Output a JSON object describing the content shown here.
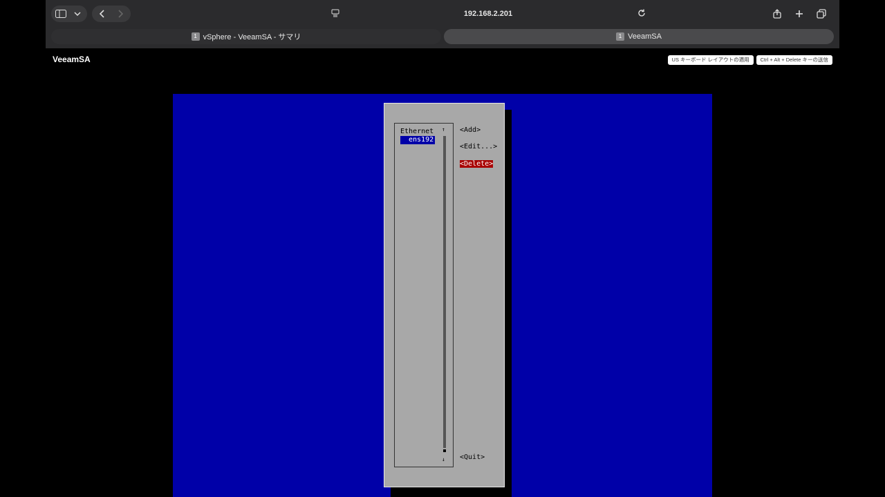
{
  "browser": {
    "address": "192.168.2.201",
    "tabs": [
      {
        "badge": "1",
        "label": "vSphere - VeeamSA - サマリ"
      },
      {
        "badge": "1",
        "label": "VeeamSA"
      }
    ]
  },
  "page": {
    "title": "VeeamSA",
    "actions": {
      "us_keyboard": "US キーボード レイアウトの適用",
      "send_cad": "Ctrl + Alt + Delete キーの送信"
    }
  },
  "console": {
    "list_header": "Ethernet",
    "list_items": [
      "ens192"
    ],
    "scroll_up": "↑",
    "scroll_down": "↓",
    "buttons": {
      "add": "<Add>",
      "edit": "<Edit...>",
      "delete": "<Delete>",
      "quit": "<Quit>"
    },
    "colors": {
      "background": "#0000a8",
      "dialog": "#a8a8a8",
      "selected_button": "#a80000"
    }
  }
}
